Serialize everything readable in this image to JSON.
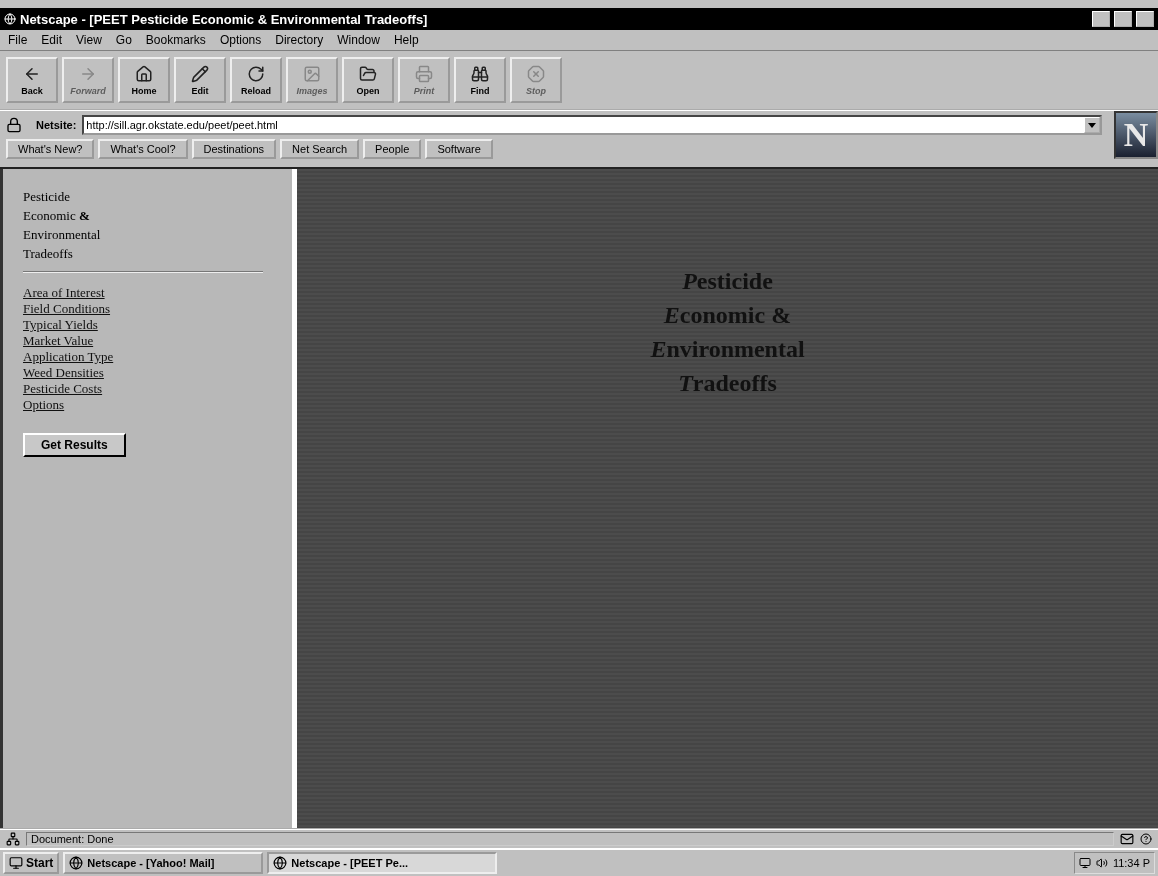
{
  "window": {
    "title": "Netscape - [PEET Pesticide Economic & Environmental Tradeoffs]"
  },
  "menu": [
    "File",
    "Edit",
    "View",
    "Go",
    "Bookmarks",
    "Options",
    "Directory",
    "Window",
    "Help"
  ],
  "toolbar": [
    {
      "kind": "back",
      "label": "Back",
      "disabled": false
    },
    {
      "kind": "forward",
      "label": "Forward",
      "disabled": true
    },
    {
      "kind": "home",
      "label": "Home",
      "disabled": false
    },
    {
      "kind": "edit",
      "label": "Edit",
      "disabled": false
    },
    {
      "kind": "reload",
      "label": "Reload",
      "disabled": false
    },
    {
      "kind": "images",
      "label": "Images",
      "disabled": true
    },
    {
      "kind": "open",
      "label": "Open",
      "disabled": false
    },
    {
      "kind": "print",
      "label": "Print",
      "disabled": true
    },
    {
      "kind": "find",
      "label": "Find",
      "disabled": false
    },
    {
      "kind": "stop",
      "label": "Stop",
      "disabled": true
    }
  ],
  "location": {
    "label": "Netsite:",
    "value": "http://sill.agr.okstate.edu/peet/peet.html"
  },
  "logo": "N",
  "directory_buttons": [
    "What's New?",
    "What's Cool?",
    "Destinations",
    "Net Search",
    "People",
    "Software"
  ],
  "sidebar": {
    "heading_lines": [
      "Pesticide",
      "Economic **&**",
      "Environmental",
      "Tradeoffs"
    ],
    "links": [
      "Area of Interest",
      "Field Conditions",
      "Typical Yields",
      "Market Value",
      "Application Type",
      "Weed Densities",
      "Pesticide Costs",
      "Options"
    ],
    "button": "Get Results"
  },
  "main": {
    "title_lines": [
      {
        "initial": "P",
        "rest": "esticide"
      },
      {
        "initial": "E",
        "rest": "conomic &"
      },
      {
        "initial": "E",
        "rest": "nvironmental"
      },
      {
        "initial": "T",
        "rest": "radeoffs"
      }
    ]
  },
  "status_bar": {
    "text": "Document: Done"
  },
  "taskbar": {
    "start": "Start",
    "tasks": [
      {
        "label": "Netscape - [Yahoo! Mail]",
        "selected": false
      },
      {
        "label": "Netscape - [PEET Pe...",
        "selected": true
      }
    ],
    "clock": "11:34 P"
  }
}
